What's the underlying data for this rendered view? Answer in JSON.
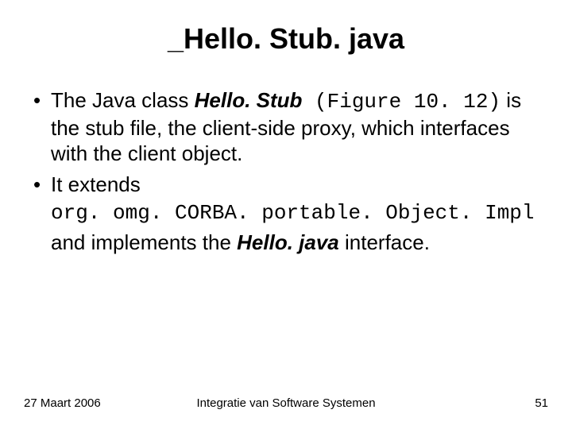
{
  "title": "_Hello. Stub. java",
  "bullet1": {
    "pre": "The Java class ",
    "class_name": "Hello. Stub",
    "figure": " (Figure 10. 12)",
    "post": " is the stub file, the client-side proxy, which interfaces with the client object."
  },
  "bullet2": {
    "pre": "It extends",
    "code": "org. omg. CORBA. portable. Object. Impl",
    "mid": "and implements the ",
    "iface": "Hello. java",
    "post": " interface."
  },
  "footer": {
    "date": "27 Maart 2006",
    "center": "Integratie van Software Systemen",
    "page": "51"
  }
}
